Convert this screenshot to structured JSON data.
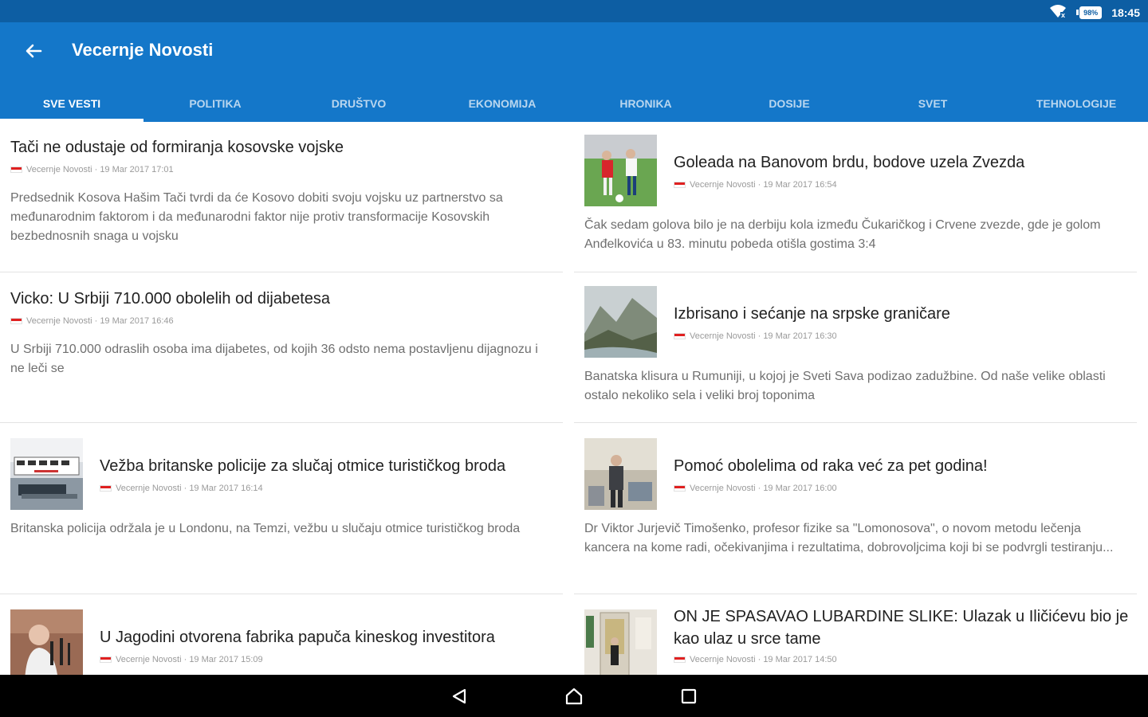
{
  "status_bar": {
    "battery": "98%",
    "time": "18:45"
  },
  "app_bar": {
    "title": "Vecernje Novosti"
  },
  "tabs": [
    {
      "label": "SVE VESTI",
      "active": true
    },
    {
      "label": "POLITIKA"
    },
    {
      "label": "DRUŠTVO"
    },
    {
      "label": "EKONOMIJA"
    },
    {
      "label": "HRONIKA"
    },
    {
      "label": "DOSIJE"
    },
    {
      "label": "SVET"
    },
    {
      "label": "TEHNOLOGIJE"
    }
  ],
  "articles": {
    "left": [
      {
        "title": "Tači ne odustaje od formiranja kosovske vojske",
        "meta": "Vecernje Novosti · 19 Mar 2017 17:01",
        "summary": "Predsednik Kosova Hašim Tači tvrdi da će Kosovo dobiti svoju vojsku uz partnerstvo sa međunarodnim faktorom i da međunarodni faktor nije protiv transformacije Kosovskih bezbednosnih snaga u vojsku",
        "thumbnail": null
      },
      {
        "title": "Vicko: U Srbiji 710.000 obolelih od dijabetesa",
        "meta": "Vecernje Novosti · 19 Mar 2017 16:46",
        "summary": "U Srbiji 710.000 odraslih osoba ima dijabetes, od kojih 36 odsto nema postavljenu dijagnozu i ne leči se",
        "thumbnail": null
      },
      {
        "title": "Vežba britanske policije za slučaj otmice turističkog broda",
        "meta": "Vecernje Novosti · 19 Mar 2017 16:14",
        "summary": "Britanska policija održala je u Londonu, na Temzi, vežbu u slučaju otmice turističkog broda",
        "thumbnail": "boat"
      },
      {
        "title": "U Jagodini otvorena fabrika papuča kineskog investitora",
        "meta": "Vecernje Novosti · 19 Mar 2017 15:09",
        "summary": "",
        "thumbnail": "speaker"
      }
    ],
    "right": [
      {
        "title": "Goleada na Banovom brdu, bodove uzela Zvezda",
        "meta": "Vecernje Novosti · 19 Mar 2017 16:54",
        "summary": "Čak sedam golova bilo je na derbiju kola između Čukaričkog i Crvene zvezde, gde je golom Anđelkovića u 83. minutu pobeda otišla gostima 3:4",
        "thumbnail": "football"
      },
      {
        "title": "Izbrisano i sećanje na srpske graničare",
        "meta": "Vecernje Novosti · 19 Mar 2017 16:30",
        "summary": "Banatska klisura u Rumuniji, u kojoj je Sveti Sava podizao zadužbine. Od naše velike oblasti ostalo nekoliko sela i veliki broj toponima",
        "thumbnail": "landscape"
      },
      {
        "title": "Pomoć obolelima od raka već za pet godina!",
        "meta": "Vecernje Novosti · 19 Mar 2017 16:00",
        "summary": "Dr Viktor Jurjevič Timošenko, profesor fizike sa \"Lomonosova\", o novom metodu lečenja kancera na kome radi, očekivanjima i rezultatima, dobrovoljcima koji bi se podvrgli testiranju...",
        "thumbnail": "lab"
      },
      {
        "title": "ON JE SPASAVAO LUBARDINE SLIKE: Ulazak u Iličićevu bio je kao ulaz u srce tame",
        "meta": "Vecernje Novosti · 19 Mar 2017 14:50",
        "summary": "",
        "thumbnail": "gallery"
      }
    ]
  }
}
